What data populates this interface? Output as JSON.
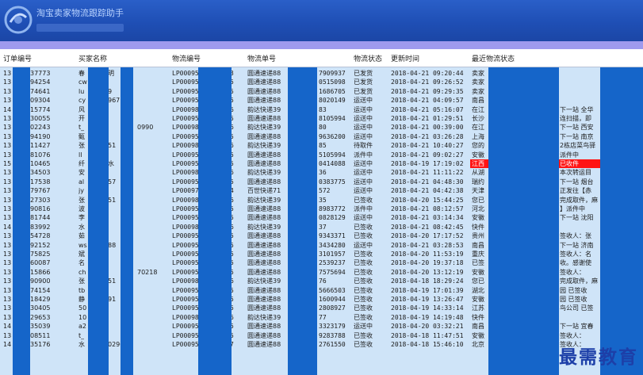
{
  "window": {
    "title": "淘宝卖家物流跟踪助手"
  },
  "columns": [
    "订单编号",
    "买家名称",
    "物流编号",
    "物流单号",
    "物流状态",
    "更新时间",
    "最近物流状态"
  ],
  "rows": [
    {
      "order": "13",
      "buyer": "春",
      "lid": "LP00095",
      "courier": "圆通速递88",
      "tail": "7909937",
      "status": "已发货",
      "time": "2018-04-21 09:20:44",
      "latest": "卖家"
    },
    {
      "order": "13",
      "buyer": "cw",
      "lid": "LP00095",
      "courier": "圆通速递88",
      "tail": "0515098",
      "status": "已发货",
      "time": "2018-04-21 09:26:52",
      "latest": "卖家"
    },
    {
      "order": "13",
      "buyer": "lu",
      "lid": "LP00095",
      "courier": "圆通速递88",
      "tail": "1686705",
      "status": "已发货",
      "time": "2018-04-21 09:29:35",
      "latest": "卖家"
    },
    {
      "order": "13",
      "buyer": "cy",
      "lid": "LP00095",
      "courier": "圆通速递88",
      "tail": "8020149",
      "status": "运送中",
      "time": "2018-04-21 04:09:57",
      "latest": "南昌"
    },
    {
      "order": "14",
      "buyer": "风",
      "lid": "LP00098",
      "courier": "韵达快递39",
      "tail": "83",
      "status": "运送中",
      "time": "2018-04-21 05:16:07",
      "latest": "在江"
    },
    {
      "order": "13",
      "buyer": "开",
      "lid": "LP00095",
      "courier": "圆通速递88",
      "tail": "8105994",
      "status": "运送中",
      "time": "2018-04-21 01:29:51",
      "latest": "长沙"
    },
    {
      "order": "13",
      "buyer": "t_",
      "lid": "LP00098",
      "courier": "韵达快递39",
      "tail": "80",
      "status": "运送中",
      "time": "2018-04-21 00:39:00",
      "latest": "在江"
    },
    {
      "order": "13",
      "buyer": "甄",
      "lid": "LP00095",
      "courier": "圆通速递88",
      "tail": "9636200",
      "status": "运送中",
      "time": "2018-04-21 03:26:28",
      "latest": "上海"
    },
    {
      "order": "13",
      "buyer": "张",
      "lid": "LP00098",
      "courier": "韵达快递39",
      "tail": "85",
      "status": "待取件",
      "time": "2018-04-21 10:40:27",
      "latest": "您的"
    },
    {
      "order": "13",
      "buyer": "ll",
      "lid": "LP00095",
      "courier": "圆通速递88",
      "tail": "5105994",
      "status": "派件中",
      "time": "2018-04-21 09:02:27",
      "latest": "安徽"
    },
    {
      "order": "15",
      "buyer": "纤",
      "lid": "LP00095",
      "courier": "圆通速递88",
      "tail": "0414088",
      "status": "运送中",
      "time": "2018-04-19 17:19:02",
      "latest": "江西"
    },
    {
      "order": "13",
      "buyer": "安",
      "lid": "LP00098",
      "courier": "韵达快递39",
      "tail": "36",
      "status": "运送中",
      "time": "2018-04-21 11:11:22",
      "latest": "从湖"
    },
    {
      "order": "13",
      "buyer": "al",
      "lid": "LP00095",
      "courier": "圆通速递88",
      "tail": "0383775",
      "status": "运送中",
      "time": "2018-04-21 04:48:30",
      "latest": "瑞约"
    },
    {
      "order": "13",
      "buyer": "jy",
      "lid": "LP00097",
      "courier": "百世快递71",
      "tail": "572",
      "status": "运送中",
      "time": "2018-04-21 04:42:38",
      "latest": "天津"
    },
    {
      "order": "13",
      "buyer": "张",
      "lid": "LP00098",
      "courier": "韵达快递39",
      "tail": "35",
      "status": "已签收",
      "time": "2018-04-20 15:44:25",
      "latest": "您已"
    },
    {
      "order": "13",
      "buyer": "波",
      "lid": "LP00095",
      "courier": "圆通速递88",
      "tail": "8983772",
      "status": "派件中",
      "time": "2018-04-21 08:12:57",
      "latest": "河北"
    },
    {
      "order": "13",
      "buyer": "李",
      "lid": "LP00095",
      "courier": "圆通速递88",
      "tail": "0828129",
      "status": "运送中",
      "time": "2018-04-21 03:14:34",
      "latest": "安徽"
    },
    {
      "order": "14",
      "buyer": "水",
      "lid": "LP00098",
      "courier": "韵达快递39",
      "tail": "37",
      "status": "已签收",
      "time": "2018-04-21 08:42:45",
      "latest": "快件"
    },
    {
      "order": "13",
      "buyer": "茹",
      "lid": "LP00095",
      "courier": "圆通速递88",
      "tail": "9343371",
      "status": "已签收",
      "time": "2018-04-20 17:17:52",
      "latest": "贵州"
    },
    {
      "order": "13",
      "buyer": "ws",
      "lid": "LP00095",
      "courier": "圆通速递88",
      "tail": "3434280",
      "status": "运送中",
      "time": "2018-04-21 03:28:53",
      "latest": "南昌"
    },
    {
      "order": "13",
      "buyer": "斌",
      "lid": "LP00095",
      "courier": "圆通速递88",
      "tail": "3101957",
      "status": "已签收",
      "time": "2018-04-20 11:53:19",
      "latest": "重庆"
    },
    {
      "order": "13",
      "buyer": "名",
      "lid": "LP00095",
      "courier": "圆通速递88",
      "tail": "2539237",
      "status": "已签收",
      "time": "2018-04-20 19:37:18",
      "latest": "已签"
    },
    {
      "order": "13",
      "buyer": "ch",
      "lid": "LP00095",
      "courier": "圆通速递88",
      "tail": "7575694",
      "status": "已签收",
      "time": "2018-04-20 13:12:19",
      "latest": "安徽"
    },
    {
      "order": "13",
      "buyer": "张",
      "lid": "LP00098",
      "courier": "韵达快递39",
      "tail": "76",
      "status": "已签收",
      "time": "2018-04-18 18:29:24",
      "latest": "您已"
    },
    {
      "order": "13",
      "buyer": "tb",
      "lid": "LP00095",
      "courier": "圆通速递88",
      "tail": "5666503",
      "status": "已签收",
      "time": "2018-04-19 17:01:39",
      "latest": "湖北"
    },
    {
      "order": "13",
      "buyer": "静",
      "lid": "LP00095",
      "courier": "圆通速递88",
      "tail": "1600944",
      "status": "已签收",
      "time": "2018-04-19 13:26:47",
      "latest": "安徽"
    },
    {
      "order": "13",
      "buyer": "50",
      "lid": "LP00095",
      "courier": "圆通速递88",
      "tail": "2808927",
      "status": "已签收",
      "time": "2018-04-19 14:33:14",
      "latest": "江苏"
    },
    {
      "order": "13",
      "buyer": "10",
      "lid": "LP00098",
      "courier": "韵达快递39",
      "tail": "77",
      "status": "已签收",
      "time": "2018-04-19 14:19:48",
      "latest": "快件"
    },
    {
      "order": "14",
      "buyer": "a2",
      "lid": "LP00095",
      "courier": "圆通速递88",
      "tail": "3323179",
      "status": "运送中",
      "time": "2018-04-20 03:32:21",
      "latest": "南昌"
    },
    {
      "order": "13",
      "buyer": "t_",
      "lid": "LP00095",
      "courier": "圆通速递88",
      "tail": "9283788",
      "status": "已签收",
      "time": "2018-04-18 11:47:51",
      "latest": "安徽"
    },
    {
      "order": "14",
      "buyer": "水",
      "lid": "LP00095",
      "courier": "圆通速递88",
      "tail": "2761550",
      "status": "已签收",
      "time": "2018-04-18 15:46:10",
      "latest": "北京"
    }
  ],
  "fragments": {
    "order_mid": [
      "37773",
      "94254",
      "74641",
      "09304",
      "15774",
      "30055",
      "02243",
      "94190",
      "11427",
      "81076",
      "10465",
      "34503",
      "17538",
      "79767",
      "27303",
      "90816",
      "81744",
      "83992",
      "54728",
      "92152",
      "75825",
      "60087",
      "15866",
      "90900",
      "74154",
      "18429",
      "30405",
      "29653",
      "35039",
      "08511",
      "35176"
    ],
    "buyer_mid": [
      "明",
      "",
      "9",
      "967",
      "",
      "",
      "",
      "",
      "51",
      "",
      "水",
      "",
      "57",
      "",
      "51",
      "",
      "",
      "",
      "",
      "88",
      "",
      "",
      "",
      "51",
      "",
      "91",
      "",
      "",
      "",
      "",
      "0296"
    ],
    "buyer_tail": [
      "",
      "",
      "",
      "",
      "",
      "",
      "0990",
      "",
      "",
      "",
      "",
      "",
      "",
      "",
      "",
      "",
      "",
      "",
      "",
      "",
      "",
      "",
      "70218",
      "",
      "",
      "",
      "",
      "",
      "",
      "",
      ""
    ],
    "lid_tail": [
      "3",
      "5",
      "5",
      "5",
      "6",
      "5",
      "6",
      "5",
      "6",
      "5",
      "5",
      "6",
      "5",
      "4",
      "6",
      "5",
      "5",
      "6",
      "5",
      "5",
      "5",
      "5",
      "5",
      "6",
      "5",
      "5",
      "5",
      "6",
      "5",
      "5",
      "7"
    ],
    "latest_right": [
      "",
      "",
      "",
      "",
      "下一站 全华",
      "连扫描，即",
      "下一站 西安",
      "下一站 南京",
      "2栋店菜鸟驿",
      "派件中",
      "已收件",
      "本次转运目",
      "下一站 烟台",
      "正发往【赤",
      "完成取件，麻",
      "】派件中",
      "下一站 沈阳",
      "",
      "签收人：张",
      "下一站 济南",
      "签收人：名",
      "收。感谢使",
      "签收人：",
      "完成取件，麻",
      "园 已签收",
      "园 已签收",
      "鸟公司 已签",
      "",
      "下一站 宜春",
      "签收人：",
      "签收人："
    ]
  },
  "watermark": "最需教育",
  "colors": {
    "title_bar": "#1f4fb5",
    "strip": "#9e9aee",
    "grid_bg": "#cfe4f8",
    "redaction": "#1565c9",
    "highlight": "#ff1414"
  }
}
